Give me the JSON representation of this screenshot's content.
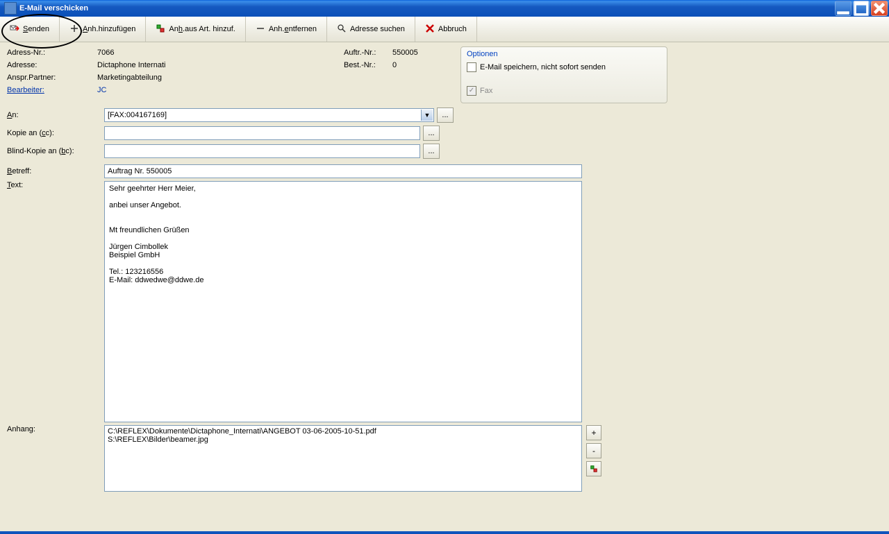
{
  "window": {
    "title": "E-Mail verschicken"
  },
  "toolbar": {
    "send": "Senden",
    "add_attach": "Anh.hinzufügen",
    "add_attach_from_art": "Anh.aus Art. hinzuf.",
    "remove_attach": "Anh.entfernen",
    "search_address": "Adresse suchen",
    "cancel": "Abbruch"
  },
  "info": {
    "address_nr_label": "Adress-Nr.:",
    "address_nr": "7066",
    "address_label": "Adresse:",
    "address": "Dictaphone Internati",
    "contact_label": "Anspr.Partner:",
    "contact": "Marketingabteilung",
    "editor_label": "Bearbeiter:",
    "editor": "JC",
    "order_nr_label": "Auftr.-Nr.:",
    "order_nr": "550005",
    "best_nr_label": "Best.-Nr.:",
    "best_nr": "0"
  },
  "options": {
    "legend": "Optionen",
    "save_not_send": "E-Mail speichern, nicht sofort senden",
    "save_not_send_checked": false,
    "fax_label": "Fax",
    "fax_checked": true
  },
  "form": {
    "to_label": "An:",
    "to_value": "[FAX:004167169]",
    "cc_label_pre": "Kopie an (",
    "cc_label_u": "c",
    "cc_label_post": "c):",
    "cc_value": "",
    "bcc_label_pre": "Blind-Kopie an (",
    "bcc_label_u": "b",
    "bcc_label_post": "c):",
    "bcc_value": "",
    "subject_label": "Betreff:",
    "subject_value": "Auftrag Nr. 550005",
    "text_label": "Text:",
    "body": "Sehr geehrter Herr Meier,\n\nanbei unser Angebot.\n\n\nMt freundlichen Grüßen\n\nJürgen Cimbollek\nBeispiel GmbH\n\nTel.: 123216556\nE-Mail: ddwedwe@ddwe.de",
    "attach_label": "Anhang:",
    "attachments": [
      "C:\\REFLEX\\Dokumente\\Dictaphone_Internati\\ANGEBOT 03-06-2005-10-51.pdf",
      "S:\\REFLEX\\Bilder\\beamer.jpg"
    ]
  },
  "misc": {
    "ellipsis": "...",
    "plus": "+",
    "minus": "-",
    "check": "✓",
    "dropdown": "▼"
  }
}
